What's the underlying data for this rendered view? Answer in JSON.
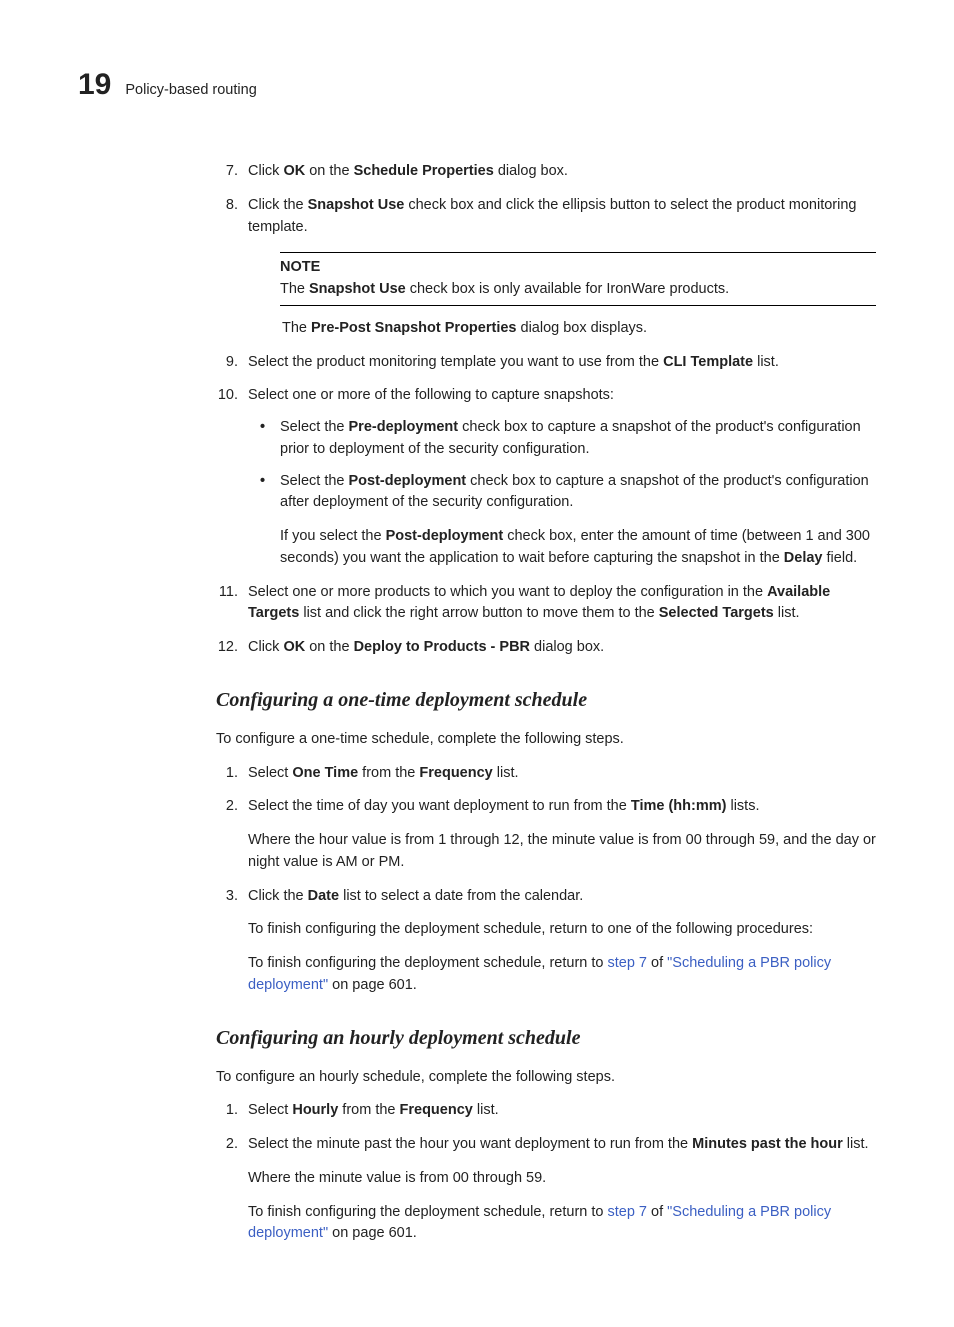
{
  "header": {
    "chapter_num": "19",
    "section_title": "Policy-based routing"
  },
  "steps_top": [
    {
      "num": "7.",
      "text_before": "Click ",
      "b1": "OK",
      "text_mid": " on the ",
      "b2": "Schedule Properties",
      "text_after": " dialog box."
    },
    {
      "num": "8.",
      "text_before": "Click the ",
      "b1": "Snapshot Use",
      "text_after": " check box and click the ellipsis button to select the product monitoring template."
    }
  ],
  "note": {
    "label": "NOTE",
    "text_before": "The ",
    "b1": "Snapshot Use",
    "text_after": " check box is only available for IronWare products."
  },
  "after_note_1": {
    "text_before": "The ",
    "b1": "Pre-Post Snapshot Properties",
    "text_after": " dialog box displays."
  },
  "step9": {
    "num": "9.",
    "text_before": "Select the product monitoring template you want to use from the ",
    "b1": "CLI Template",
    "text_after": " list."
  },
  "step10": {
    "num": "10.",
    "text": "Select one or more of the following to capture snapshots:",
    "bullets": [
      {
        "text_before": "Select the ",
        "b1": "Pre-deployment",
        "text_after": " check box to capture a snapshot of the product's configuration prior to deployment of the security configuration."
      },
      {
        "text_before": "Select the ",
        "b1": "Post-deployment",
        "text_after": " check box to capture a snapshot of the product's configuration after deployment of the security configuration.",
        "sub": {
          "t1": "If you select the ",
          "b1": "Post-deployment",
          "t2": " check box, enter the amount of time (between 1 and 300 seconds) you want the application to wait before capturing the snapshot in the ",
          "b2": "Delay",
          "t3": " field."
        }
      }
    ]
  },
  "step11": {
    "num": "11.",
    "t1": "Select one or more products to which you want to deploy the configuration in the ",
    "b1": "Available Targets",
    "t2": " list and click the right arrow button to move them to the ",
    "b2": "Selected Targets",
    "t3": " list."
  },
  "step12": {
    "num": "12.",
    "t1": "Click ",
    "b1": "OK",
    "t2": " on the ",
    "b2": "Deploy to Products - PBR",
    "t3": " dialog box."
  },
  "section1": {
    "heading": "Configuring a one-time deployment schedule",
    "intro": "To configure a one-time schedule, complete the following steps.",
    "steps": [
      {
        "num": "1.",
        "t1": "Select ",
        "b1": "One Time",
        "t2": " from the ",
        "b2": "Frequency",
        "t3": " list."
      },
      {
        "num": "2.",
        "t1": "Select the time of day you want deployment to run from the ",
        "b1": "Time (hh:mm)",
        "t2": " lists.",
        "p2": "Where the hour value is from 1 through 12, the minute value is from 00 through 59, and the day or night value is AM or PM."
      },
      {
        "num": "3.",
        "t1": "Click the ",
        "b1": "Date",
        "t2": " list to select a date from the calendar.",
        "p2": "To finish configuring the deployment schedule, return to one of the following procedures:",
        "p3": {
          "t1": "To finish configuring the deployment schedule, return to ",
          "link1": "step 7",
          "t2": " of ",
          "link2": "\"Scheduling a PBR policy deployment\"",
          "t3": " on page 601."
        }
      }
    ]
  },
  "section2": {
    "heading": "Configuring an hourly deployment schedule",
    "intro": "To configure an hourly schedule, complete the following steps.",
    "steps": [
      {
        "num": "1.",
        "t1": "Select ",
        "b1": "Hourly",
        "t2": " from the ",
        "b2": "Frequency",
        "t3": " list."
      },
      {
        "num": "2.",
        "t1": "Select the minute past the hour you want deployment to run from the ",
        "b1": "Minutes past the hour",
        "t2": " list.",
        "p2": "Where the minute value is from 00 through 59.",
        "p3": {
          "t1": "To finish configuring the deployment schedule, return to ",
          "link1": "step 7",
          "t2": " of ",
          "link2": "\"Scheduling a PBR policy deployment\"",
          "t3": " on page 601."
        }
      }
    ]
  }
}
